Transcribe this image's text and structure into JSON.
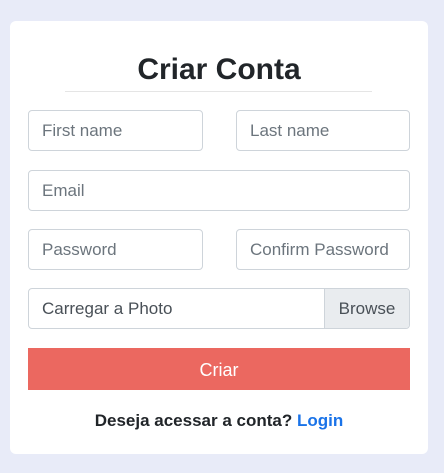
{
  "form": {
    "title": "Criar Conta",
    "first_name_placeholder": "First name",
    "last_name_placeholder": "Last name",
    "email_placeholder": "Email",
    "password_placeholder": "Password",
    "confirm_password_placeholder": "Confirm Password",
    "photo_label": "Carregar a Photo",
    "browse_label": "Browse",
    "submit_label": "Criar",
    "login_prompt": "Deseja acessar a conta?",
    "login_link": "Login"
  },
  "colors": {
    "background": "#e8ebf8",
    "submit": "#eb6860",
    "link": "#1a73e8"
  }
}
